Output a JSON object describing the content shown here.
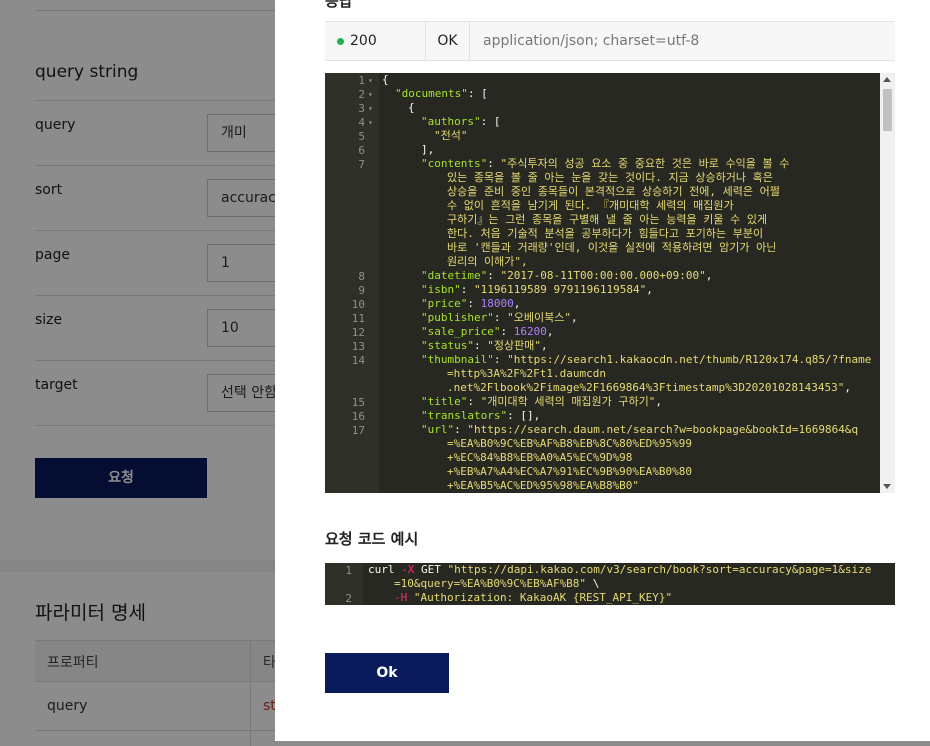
{
  "background": {
    "query_string_title": "query string",
    "fields": [
      {
        "label": "query",
        "value": "개미"
      },
      {
        "label": "sort",
        "value": "accuracy"
      },
      {
        "label": "page",
        "value": "1"
      },
      {
        "label": "size",
        "value": "10"
      },
      {
        "label": "target",
        "value": "선택 안함"
      }
    ],
    "request_button": "요청",
    "param_title": "파라미터 명세",
    "table_header": [
      "프로퍼티",
      "타"
    ],
    "table_row": [
      "query",
      "st"
    ]
  },
  "modal": {
    "response_title": "응답",
    "status_code": "200",
    "status_text": "OK",
    "content_type": "application/json; charset=utf-8",
    "response_code_lines": [
      {
        "n": "1",
        "fold": true
      },
      {
        "n": "2",
        "fold": true
      },
      {
        "n": "3",
        "fold": true
      },
      {
        "n": "4",
        "fold": true
      },
      {
        "n": "5"
      },
      {
        "n": "6"
      },
      {
        "n": "7"
      },
      {
        "n": "8"
      },
      {
        "n": "9"
      },
      {
        "n": "10"
      },
      {
        "n": "11"
      },
      {
        "n": "12"
      },
      {
        "n": "13"
      },
      {
        "n": "14"
      },
      {
        "n": "15"
      },
      {
        "n": "16"
      },
      {
        "n": "17"
      }
    ],
    "json": {
      "open_brace": "{",
      "documents_key": "\"documents\"",
      "open_bracket": "[",
      "open_obj": "{",
      "authors_key": "\"authors\"",
      "author_0": "\"전석\"",
      "authors_close": "],",
      "contents_key": "\"contents\"",
      "contents_lines": [
        "\"주식투자의 성공 요소 중 중요한 것은 바로 수익을 볼 수",
        "있는 종목을 볼 줄 아는 눈을 갖는 것이다. 지금 상승하거나 혹은",
        "상승을 준비 중인 종목들이 본격적으로 상승하기 전에, 세력은 어쩔",
        "수 없이 흔적을 남기게 된다. 『개미대학 세력의 매집원가",
        "구하기』는 그런 종목을 구별해 낼 줄 아는 능력을 키울 수 있게",
        "한다. 처음 기술적 분석을 공부하다가 힘들다고 포기하는 부분이",
        "바로 '캔들과 거래량'인데, 이것을 실전에 적용하려면 암기가 아닌",
        "원리의 이해가\","
      ],
      "datetime_key": "\"datetime\"",
      "datetime_val": "\"2017-08-11T00:00:00.000+09:00\"",
      "isbn_key": "\"isbn\"",
      "isbn_val": "\"1196119589 9791196119584\"",
      "price_key": "\"price\"",
      "price_val": "18000",
      "publisher_key": "\"publisher\"",
      "publisher_val": "\"오베이북스\"",
      "sale_price_key": "\"sale_price\"",
      "sale_price_val": "16200",
      "status_key": "\"status\"",
      "status_val": "\"정상판매\"",
      "thumbnail_key": "\"thumbnail\"",
      "thumbnail_lines": [
        "\"https://search1.kakaocdn.net/thumb/R120x174.q85/?fname",
        "=http%3A%2F%2Ft1.daumcdn",
        ".net%2Flbook%2Fimage%2F1669864%3Ftimestamp%3D20201028143453\""
      ],
      "title_key": "\"title\"",
      "title_val": "\"개미대학 세력의 매집원가 구하기\"",
      "translators_key": "\"translators\"",
      "translators_val": "[],",
      "url_key": "\"url\"",
      "url_lines": [
        "\"https://search.daum.net/search?w=bookpage&bookId=1669864&q",
        "=%EA%B0%9C%EB%AF%B8%EB%8C%80%ED%95%99",
        "+%EC%84%B8%EB%A0%A5%EC%9D%98",
        "+%EB%A7%A4%EC%A7%91%EC%9B%90%EA%B0%80",
        "+%EA%B5%AC%ED%95%98%EA%B8%B0\""
      ]
    },
    "request_example_title": "요청 코드 예시",
    "request_lines": [
      {
        "n": "1"
      },
      {
        "n": "2"
      }
    ],
    "curl": {
      "cmd": "curl",
      "x_flag": "-X",
      "method": "GET",
      "url_a": "\"https://dapi.kakao.com/v3/search/book?sort=accuracy&page=1&size",
      "url_b": "=10&query=%EA%B0%9C%EB%AF%B8\"",
      "cont": "\\",
      "h_flag": "-H",
      "header": "\"Authorization: KakaoAK {REST_API_KEY}\""
    },
    "ok_button": "Ok"
  }
}
